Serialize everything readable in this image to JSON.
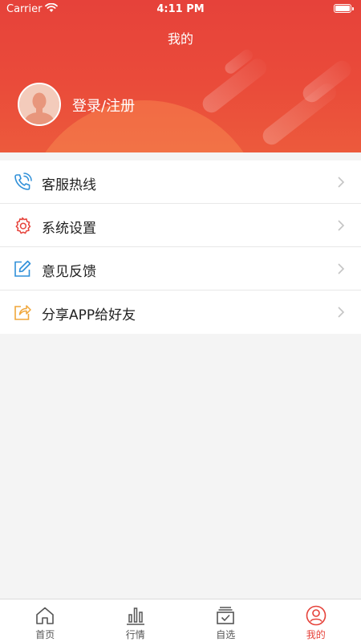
{
  "status_bar": {
    "carrier": "Carrier",
    "time": "4:11 PM"
  },
  "header": {
    "title": "我的",
    "login_label": "登录/注册",
    "gradient_top": "#e6423a",
    "gradient_bottom": "#ec5a3c"
  },
  "menu": {
    "items": [
      {
        "label": "客服热线",
        "icon": "phone-icon",
        "icon_color": "#2f8fd8"
      },
      {
        "label": "系统设置",
        "icon": "gear-icon",
        "icon_color": "#e6423a"
      },
      {
        "label": "意见反馈",
        "icon": "edit-icon",
        "icon_color": "#2f8fd8"
      },
      {
        "label": "分享APP给好友",
        "icon": "share-icon",
        "icon_color": "#f0a63a"
      }
    ]
  },
  "tabbar": {
    "tabs": [
      {
        "label": "首页",
        "icon": "home-icon",
        "active": false
      },
      {
        "label": "行情",
        "icon": "chart-icon",
        "active": false
      },
      {
        "label": "自选",
        "icon": "favorites-icon",
        "active": false
      },
      {
        "label": "我的",
        "icon": "profile-icon",
        "active": true
      }
    ],
    "active_color": "#e6423a"
  }
}
